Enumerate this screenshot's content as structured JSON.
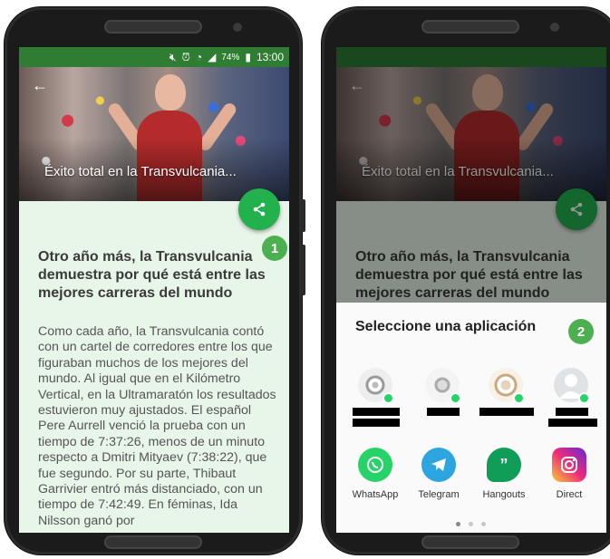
{
  "status_bar": {
    "battery": "74%",
    "time": "13:00",
    "icons": [
      "mute-icon",
      "alarm-icon",
      "wifi-icon",
      "signal-icon",
      "battery-icon"
    ]
  },
  "article": {
    "hero_title": "Éxito total en la Transvulcania...",
    "title": "Otro año más, la Transvulcania demuestra por qué está entre las mejores carreras del mundo",
    "body": "Como cada año, la Transvulcania contó con un cartel de corredores entre los que figuraban muchos de los mejores del mundo. Al igual que en el Kilómetro Vertical, en la Ultramaratón los resultados estuvieron muy ajustados. El español Pere Aurrell venció la prueba con un tiempo de 7:37:26, menos de un minuto respecto a Dmitri Mityaev (7:38:22), que fue segundo. Por su parte, Thibaut Garrivier entró más distanciado, con un tiempo de 7:42:49. En féminas, Ida Nilsson ganó por"
  },
  "step_badges": [
    "1",
    "2"
  ],
  "share_sheet": {
    "title": "Seleccione una aplicación",
    "apps": [
      {
        "label": "WhatsApp",
        "icon": "whatsapp-icon",
        "color": "#25d366"
      },
      {
        "label": "Telegram",
        "icon": "telegram-icon",
        "color": "#2ca5e0"
      },
      {
        "label": "Hangouts",
        "icon": "hangouts-icon",
        "color": "#0f9d58"
      },
      {
        "label": "Direct",
        "icon": "instagram-direct-icon",
        "color": "#d6249f"
      }
    ],
    "page_indicator": {
      "pages": 3,
      "current": 1
    }
  },
  "colors": {
    "status_bar": "#2e7d32",
    "fab": "#22b14c",
    "badge": "#4caf50",
    "article_bg": "#e8f5e9"
  }
}
